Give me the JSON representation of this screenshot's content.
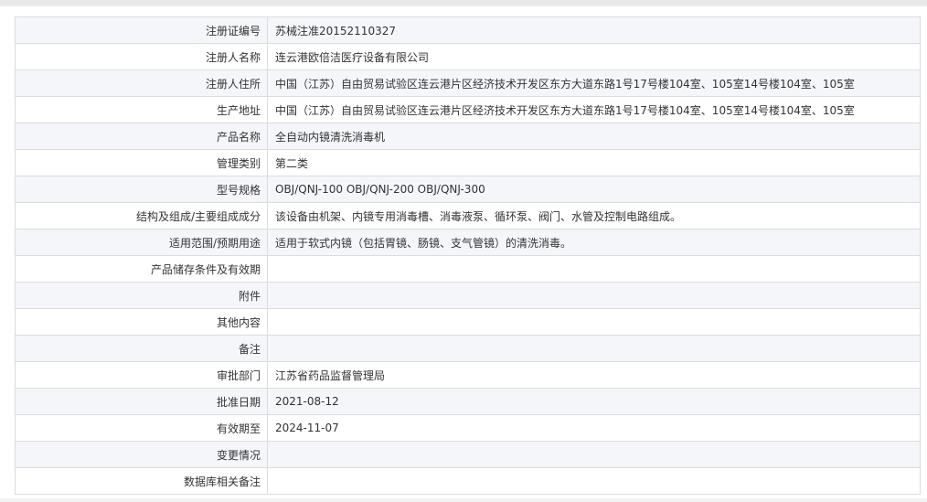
{
  "rows": [
    {
      "label": "注册证编号",
      "value": "苏械注准20152110327"
    },
    {
      "label": "注册人名称",
      "value": "连云港欧倍洁医疗设备有限公司"
    },
    {
      "label": "注册人住所",
      "value": "中国（江苏）自由贸易试验区连云港片区经济技术开发区东方大道东路1号17号楼104室、105室14号楼104室、105室"
    },
    {
      "label": "生产地址",
      "value": "中国（江苏）自由贸易试验区连云港片区经济技术开发区东方大道东路1号17号楼104室、105室14号楼104室、105室"
    },
    {
      "label": "产品名称",
      "value": "全自动内镜清洗消毒机"
    },
    {
      "label": "管理类别",
      "value": "第二类"
    },
    {
      "label": "型号规格",
      "value": "OBJ/QNJ-100 OBJ/QNJ-200 OBJ/QNJ-300"
    },
    {
      "label": "结构及组成/主要组成成分",
      "value": "该设备由机架、内镜专用消毒槽、消毒液泵、循环泵、阀门、水管及控制电路组成。"
    },
    {
      "label": "适用范围/预期用途",
      "value": "适用于软式内镜（包括胃镜、肠镜、支气管镜）的清洗消毒。"
    },
    {
      "label": "产品储存条件及有效期",
      "value": ""
    },
    {
      "label": "附件",
      "value": ""
    },
    {
      "label": "其他内容",
      "value": ""
    },
    {
      "label": "备注",
      "value": ""
    },
    {
      "label": "审批部门",
      "value": "江苏省药品监督管理局"
    },
    {
      "label": "批准日期",
      "value": "2021-08-12"
    },
    {
      "label": "有效期至",
      "value": "2024-11-07"
    },
    {
      "label": "变更情况",
      "value": ""
    },
    {
      "label": "数据库相关备注",
      "value": ""
    }
  ]
}
